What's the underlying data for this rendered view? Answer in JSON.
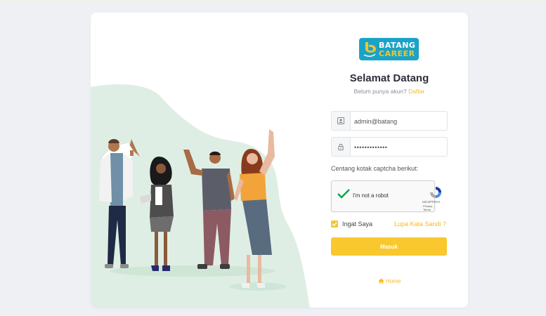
{
  "brand": {
    "line1": "BATANG",
    "line2": "CAREER",
    "accent": "#1aa3c7",
    "highlight": "#f4c430"
  },
  "heading": {
    "title": "Selamat Datang",
    "prompt": "Belum punya akun?",
    "register_link": "Daftar"
  },
  "form": {
    "username_value": "admin@batang",
    "password_value": "•••••••••••••",
    "username_icon": "id-card-icon",
    "password_icon": "lock-icon",
    "captcha_caption": "Centang kotak captcha berikut:",
    "captcha_label": "I'm not a robot",
    "captcha_brand": "reCAPTCHA",
    "captcha_links": "Privacy - Terms",
    "captcha_checked": true,
    "remember_label": "Ingat Saya",
    "remember_checked": true,
    "forgot_link": "Lupa Kata Sandi ?",
    "submit_label": "Masuk"
  },
  "footer": {
    "home_label": "Home",
    "home_icon": "home-icon"
  },
  "colors": {
    "primary": "#f9c82f",
    "link": "#f7b924",
    "blob": "#dfeee4"
  }
}
